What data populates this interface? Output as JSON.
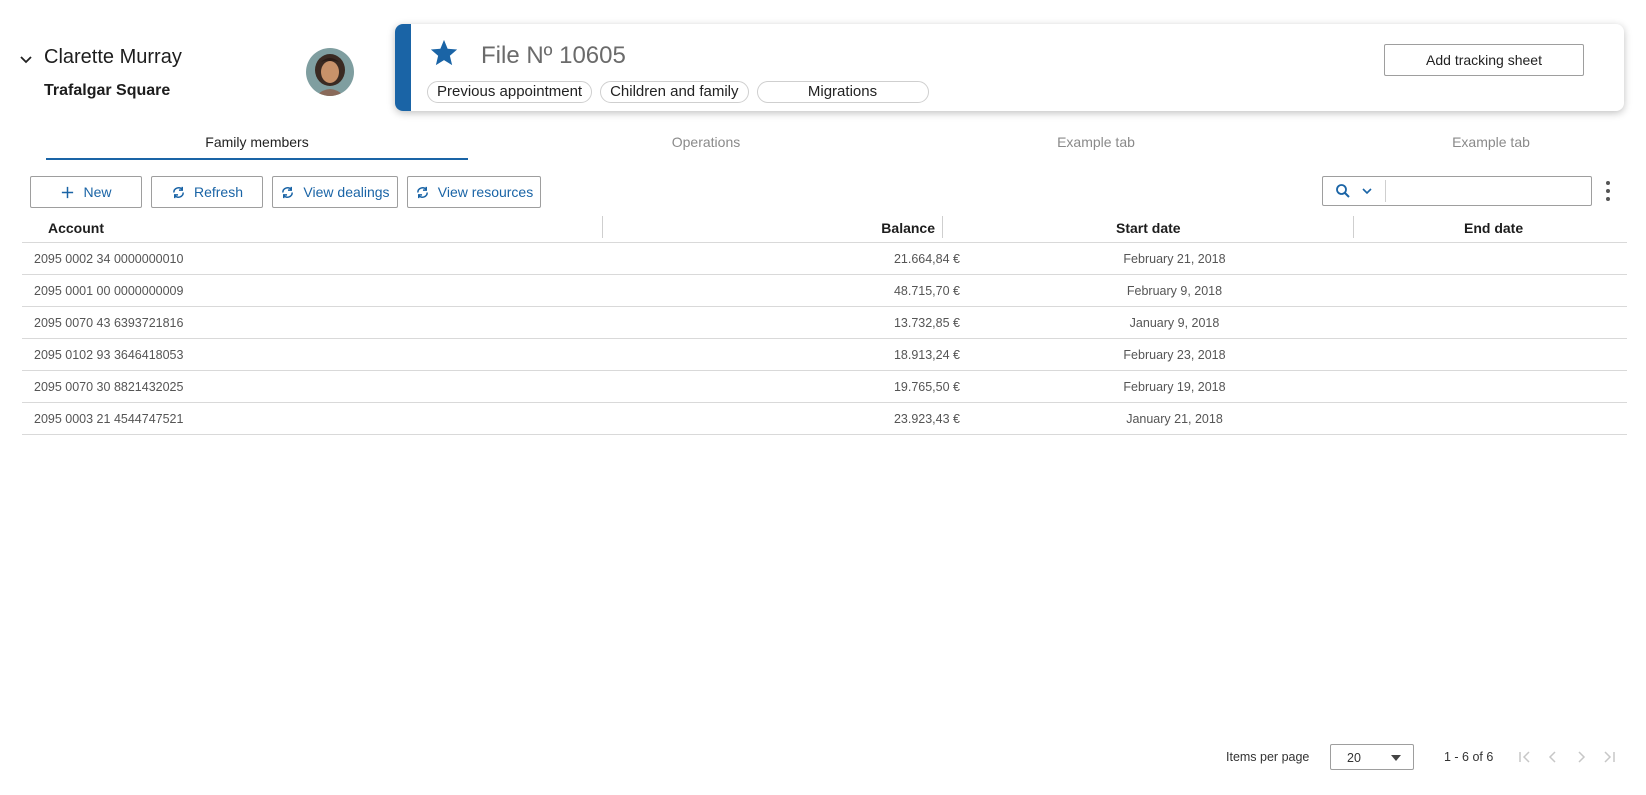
{
  "person": {
    "name": "Clarette Murray",
    "location": "Trafalgar Square"
  },
  "file": {
    "title": "File Nº 10605",
    "chips": [
      "Previous appointment",
      "Children and family",
      "Migrations"
    ],
    "add_tracking_label": "Add tracking sheet"
  },
  "tabs": [
    "Family members",
    "Operations",
    "Example tab",
    "Example tab"
  ],
  "toolbar": {
    "new_label": "New",
    "refresh_label": "Refresh",
    "view_dealings_label": "View dealings",
    "view_resources_label": "View resources"
  },
  "search": {
    "placeholder": ""
  },
  "table": {
    "columns": [
      "Account",
      "Balance",
      "Start date",
      "End date"
    ],
    "rows": [
      {
        "account": "2095 0002 34 0000000010",
        "balance": "21.664,84 €",
        "start": "February 21, 2018",
        "end": ""
      },
      {
        "account": "2095 0001 00 0000000009",
        "balance": "48.715,70 €",
        "start": "February 9, 2018",
        "end": ""
      },
      {
        "account": "2095 0070 43 6393721816",
        "balance": "13.732,85 €",
        "start": "January 9, 2018",
        "end": ""
      },
      {
        "account": "2095 0102 93 3646418053",
        "balance": "18.913,24 €",
        "start": "February 23, 2018",
        "end": ""
      },
      {
        "account": "2095 0070 30 8821432025",
        "balance": "19.765,50 €",
        "start": "February 19, 2018",
        "end": ""
      },
      {
        "account": "2095 0003 21 4544747521",
        "balance": "23.923,43 €",
        "start": "January 21, 2018",
        "end": ""
      }
    ]
  },
  "pager": {
    "items_per_page_label": "Items per page",
    "items_per_page": "20",
    "range": "1 - 6 of 6"
  },
  "colors": {
    "accent": "#1a64a6",
    "border": "#d9d9d9"
  }
}
